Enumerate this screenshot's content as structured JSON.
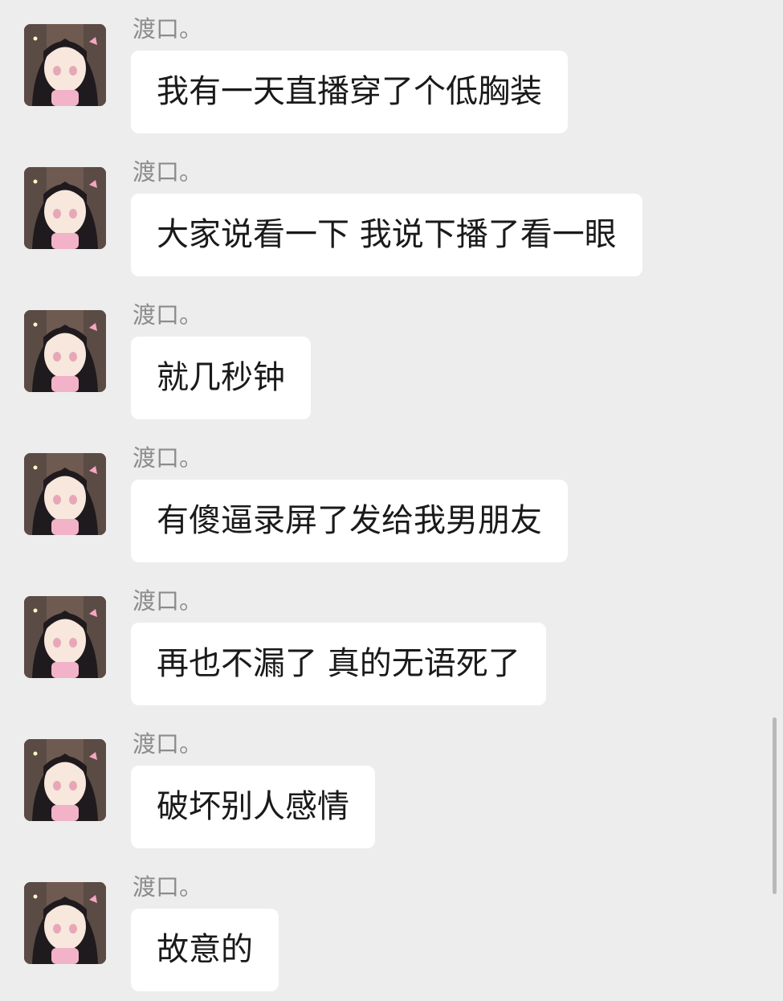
{
  "messages": [
    {
      "sender": "渡口。",
      "text": "我有一天直播穿了个低胸装"
    },
    {
      "sender": "渡口。",
      "text": "大家说看一下 我说下播了看一眼"
    },
    {
      "sender": "渡口。",
      "text": "就几秒钟"
    },
    {
      "sender": "渡口。",
      "text": "有傻逼录屏了发给我男朋友"
    },
    {
      "sender": "渡口。",
      "text": "再也不漏了  真的无语死了"
    },
    {
      "sender": "渡口。",
      "text": "破坏别人感情"
    },
    {
      "sender": "渡口。",
      "text": "故意的"
    }
  ],
  "icons": {
    "avatar": "anime-girl-avatar-icon"
  },
  "colors": {
    "background": "#ededed",
    "bubble": "#ffffff",
    "sender_text": "#8c8c8c",
    "message_text": "#1a1a1a"
  }
}
